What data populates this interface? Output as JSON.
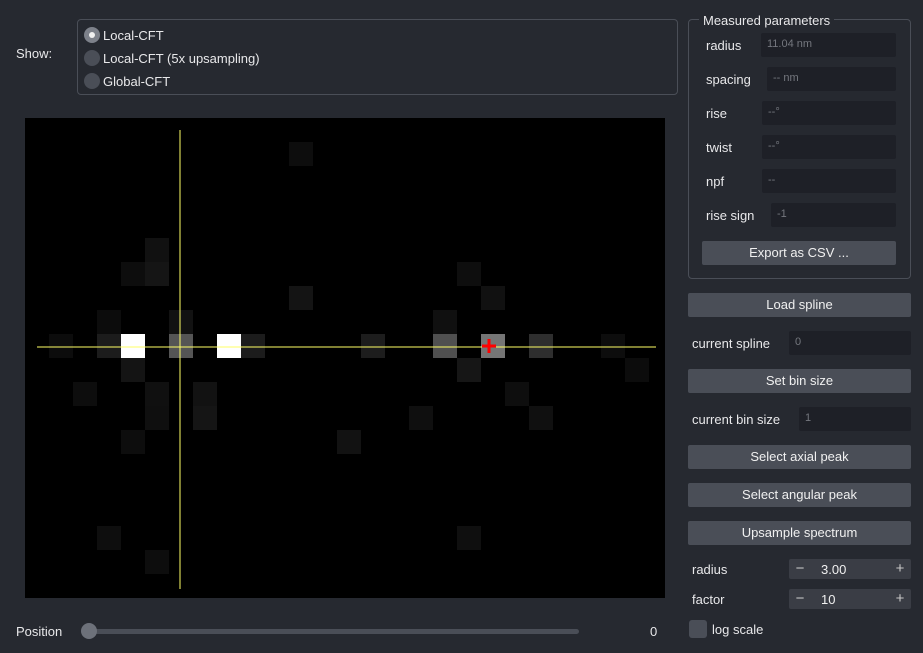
{
  "show": {
    "label": "Show:",
    "options": [
      "Local-CFT",
      "Local-CFT (5x upsampling)",
      "Global-CFT"
    ],
    "selected": "Local-CFT"
  },
  "spectrum": {
    "colors": {
      "background": "#000000",
      "crosshair": "#ffff66",
      "marker": "#ff0000"
    },
    "marker_icon": "red-cross-marker"
  },
  "position": {
    "label": "Position",
    "value": "0",
    "slider_fraction": 0.0
  },
  "params": {
    "title": "Measured parameters",
    "radius": {
      "label": "radius",
      "value": "11.04 nm"
    },
    "spacing": {
      "label": "spacing",
      "placeholder": "-- nm"
    },
    "rise": {
      "label": "rise",
      "placeholder": "--°"
    },
    "twist": {
      "label": "twist",
      "placeholder": "--°"
    },
    "npf": {
      "label": "npf",
      "placeholder": "--"
    },
    "rise_sign": {
      "label": "rise sign",
      "value": "-1"
    },
    "export_label": "Export as CSV ..."
  },
  "controls": {
    "load_spline": "Load spline",
    "current_spline_label": "current spline",
    "current_spline_value": "0",
    "set_bin_size": "Set bin size",
    "current_bin_size_label": "current bin size",
    "current_bin_size_value": "1",
    "select_axial_peak": "Select axial peak",
    "select_angular_peak": "Select angular peak",
    "upsample_spectrum": "Upsample spectrum",
    "radius_label": "radius",
    "radius_value": "3.00",
    "factor_label": "factor",
    "factor_value": "10",
    "log_scale_label": "log scale",
    "log_scale_checked": false
  }
}
